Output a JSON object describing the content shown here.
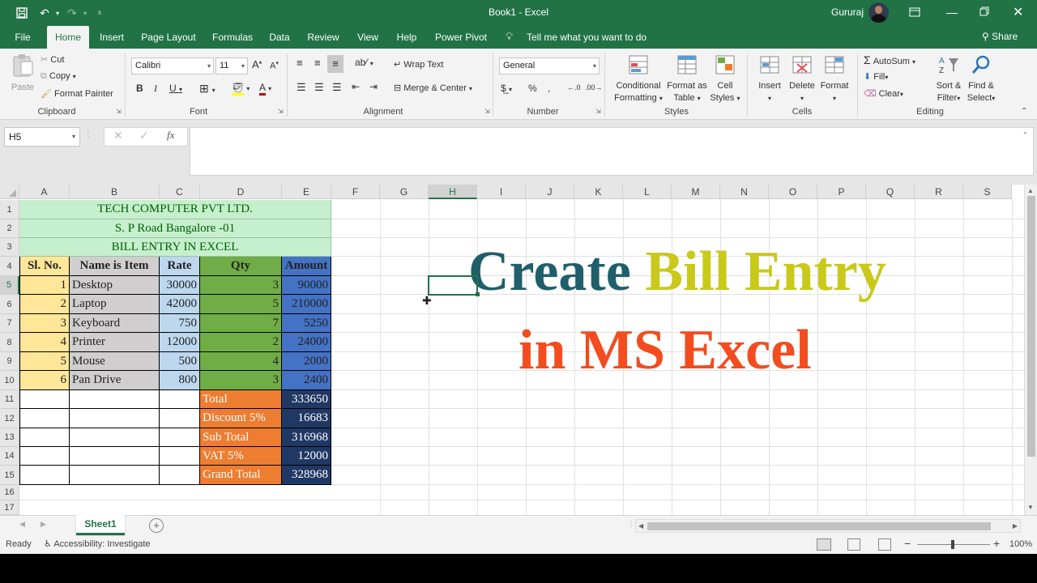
{
  "titlebar": {
    "title": "Book1  -  Excel",
    "user": "Gururaj"
  },
  "tabs": [
    "File",
    "Home",
    "Insert",
    "Page Layout",
    "Formulas",
    "Data",
    "Review",
    "View",
    "Help",
    "Power Pivot"
  ],
  "tell_me": "Tell me what you want to do",
  "share": "Share",
  "ribbon": {
    "paste": "Paste",
    "cut": "Cut",
    "copy": "Copy",
    "format_painter": "Format Painter",
    "clipboard": "Clipboard",
    "font_name": "Calibri",
    "font_size": "11",
    "font": "Font",
    "wrap_text": "Wrap Text",
    "merge_center": "Merge & Center",
    "alignment": "Alignment",
    "number_format": "General",
    "number": "Number",
    "conditional_formatting_1": "Conditional",
    "conditional_formatting_2": "Formatting",
    "format_as_table_1": "Format as",
    "format_as_table_2": "Table",
    "cell_styles_1": "Cell",
    "cell_styles_2": "Styles",
    "styles": "Styles",
    "insert": "Insert",
    "delete": "Delete",
    "format": "Format",
    "cells": "Cells",
    "autosum": "AutoSum",
    "fill": "Fill",
    "clear": "Clear",
    "sort_filter_1": "Sort &",
    "sort_filter_2": "Filter",
    "find_select_1": "Find &",
    "find_select_2": "Select",
    "editing": "Editing"
  },
  "namebox": "H5",
  "columns": [
    "A",
    "B",
    "C",
    "D",
    "E",
    "F",
    "G",
    "H",
    "I",
    "J",
    "K",
    "L",
    "M",
    "N",
    "O",
    "P",
    "Q",
    "R",
    "S"
  ],
  "rows": [
    "1",
    "2",
    "3",
    "4",
    "5",
    "6",
    "7",
    "8",
    "9",
    "10",
    "11",
    "12",
    "13",
    "14",
    "15",
    "16",
    "17"
  ],
  "sheet": {
    "title1": "TECH COMPUTER PVT LTD.",
    "title2": "S. P Road Bangalore -01",
    "title3": "BILL ENTRY IN EXCEL",
    "headers": [
      "Sl. No.",
      "Name is Item",
      "Rate",
      "Qty",
      "Amount"
    ],
    "items": [
      {
        "sl": "1",
        "name": "Desktop",
        "rate": "30000",
        "qty": "3",
        "amount": "90000"
      },
      {
        "sl": "2",
        "name": "Laptop",
        "rate": "42000",
        "qty": "5",
        "amount": "210000"
      },
      {
        "sl": "3",
        "name": "Keyboard",
        "rate": "750",
        "qty": "7",
        "amount": "5250"
      },
      {
        "sl": "4",
        "name": "Printer",
        "rate": "12000",
        "qty": "2",
        "amount": "24000"
      },
      {
        "sl": "5",
        "name": "Mouse",
        "rate": "500",
        "qty": "4",
        "amount": "2000"
      },
      {
        "sl": "6",
        "name": "Pan Drive",
        "rate": "800",
        "qty": "3",
        "amount": "2400"
      }
    ],
    "summary": [
      {
        "label": "Total",
        "value": "333650"
      },
      {
        "label": "Discount 5%",
        "value": "16683"
      },
      {
        "label": "Sub Total",
        "value": "316968"
      },
      {
        "label": "VAT 5%",
        "value": "12000"
      },
      {
        "label": "Grand Total",
        "value": "328968"
      }
    ]
  },
  "overlay": {
    "word1": "Create",
    "word2": "Bill Entry",
    "line2": "in MS Excel"
  },
  "sheet_tab": "Sheet1",
  "status": {
    "ready": "Ready",
    "accessibility": "Accessibility: Investigate",
    "zoom": "100%"
  },
  "colors": {
    "green": "#217346",
    "title_fill": "#c6efce",
    "yellow_fill": "#ffe699",
    "grey_fill": "#d0cece",
    "blue_light": "#bdd7ee",
    "qty_green": "#70ad47",
    "amount_blue": "#4472c4",
    "orange": "#ed7d31",
    "navy": "#203864",
    "teal_text": "#1f5f6b",
    "olive_text": "#c9c91a",
    "red_text": "#f24c1f"
  }
}
